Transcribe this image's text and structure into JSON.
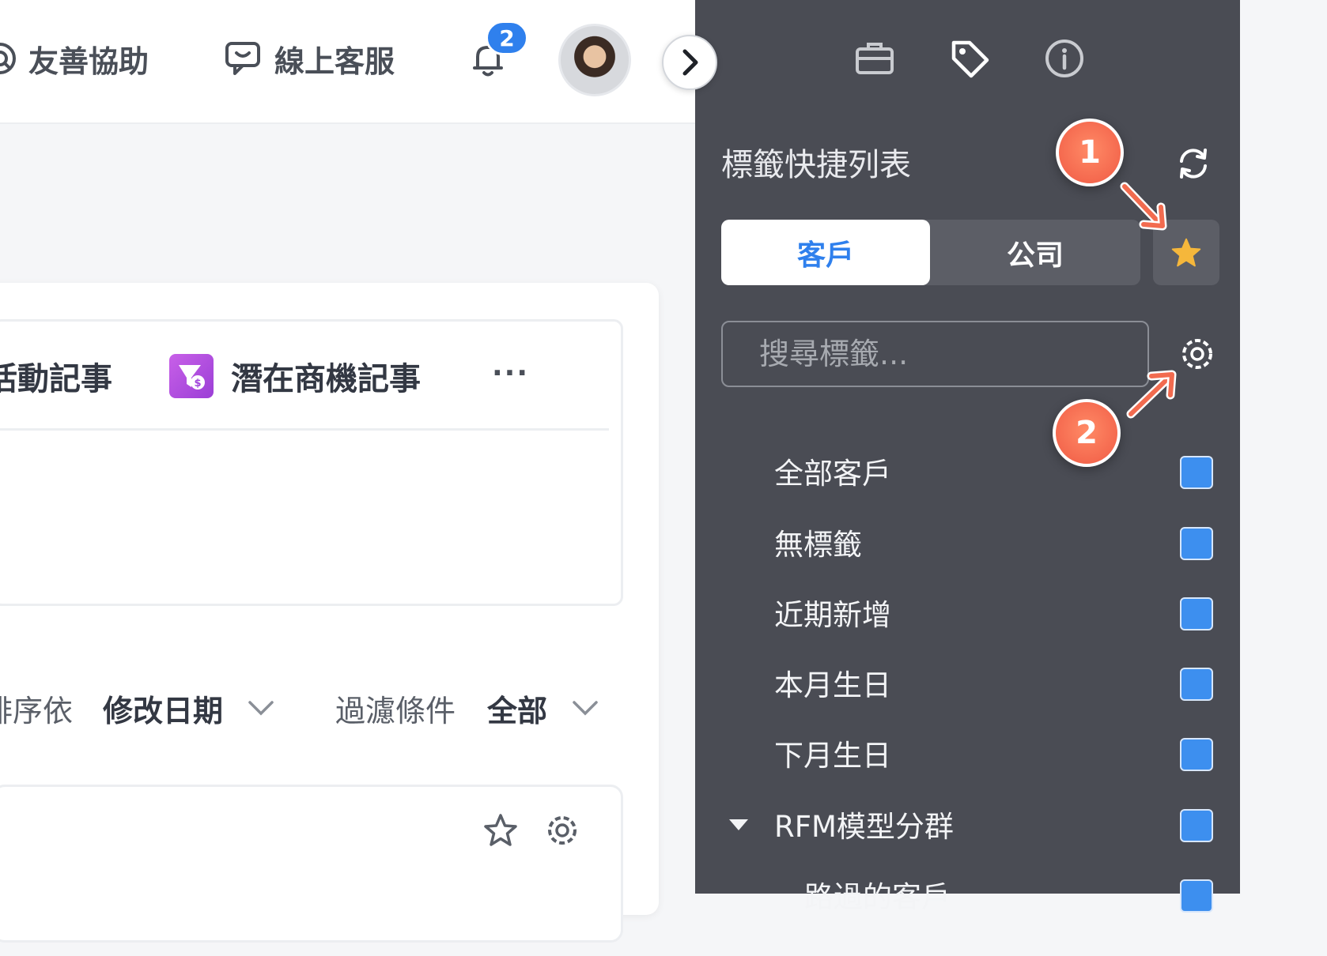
{
  "topbar": {
    "help_label": "友善協助",
    "service_label": "線上客服",
    "notification_count": "2"
  },
  "main": {
    "tabs": [
      {
        "label": "活動記事"
      },
      {
        "label": "潛在商機記事"
      }
    ],
    "more_label": "···",
    "sort": {
      "label": "排序依",
      "value": "修改日期"
    },
    "filter": {
      "label": "過濾條件",
      "value": "全部"
    }
  },
  "panel": {
    "title": "標籤快捷列表",
    "segments": [
      {
        "label": "客戶",
        "active": true
      },
      {
        "label": "公司",
        "active": false
      }
    ],
    "search_placeholder": "搜尋標籤...",
    "tags": [
      {
        "label": "全部客戶",
        "checked": true
      },
      {
        "label": "無標籤",
        "checked": true
      },
      {
        "label": "近期新增",
        "checked": true
      },
      {
        "label": "本月生日",
        "checked": true
      },
      {
        "label": "下月生日",
        "checked": true
      },
      {
        "label": "RFM模型分群",
        "checked": true,
        "expanded": true
      },
      {
        "label": "路過的客戶",
        "checked": true
      }
    ]
  },
  "annotations": [
    {
      "number": "1"
    },
    {
      "number": "2"
    }
  ],
  "colors": {
    "accent": "#2f80ed",
    "panel_bg": "#4a4c54",
    "marker": "#f26b4f",
    "favorite_star": "#f5b73b"
  }
}
